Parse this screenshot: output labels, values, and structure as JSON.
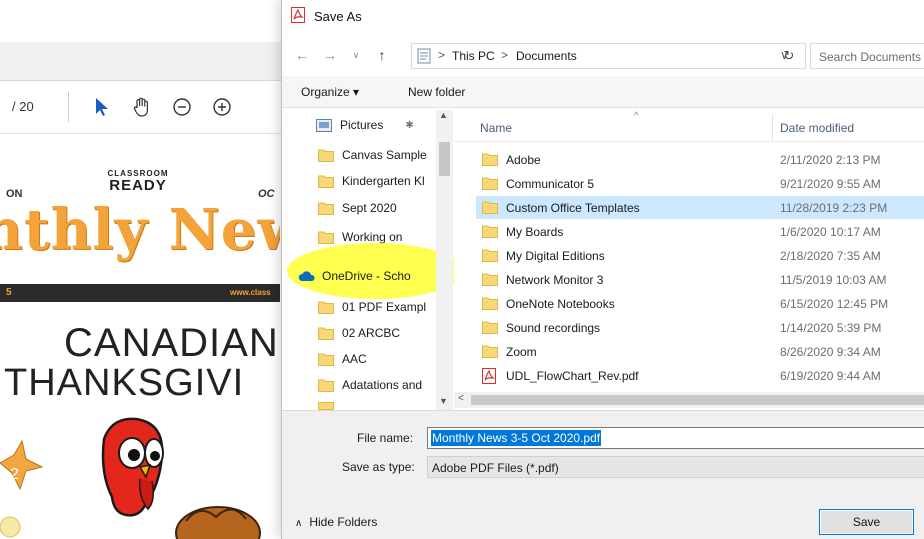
{
  "viewer": {
    "page_count": "/ 20",
    "newsletter": {
      "left_edge": "ON",
      "right_edge": "OC",
      "brand_top": "CLASSROOM",
      "brand_bottom": "READY",
      "title": "nthly New",
      "strip_left": "5",
      "strip_right": "www.class",
      "heading_1": "CANADIAN",
      "heading_2": "THANKSGIVI",
      "star_digit": "2"
    }
  },
  "dialog": {
    "title": "Save As",
    "address": {
      "crumbs": [
        "This PC",
        "Documents"
      ],
      "separator": ">"
    },
    "search_placeholder": "Search Documents",
    "toolbar": {
      "organize_label": "Organize ▾",
      "new_folder_label": "New folder"
    },
    "nav_items": [
      {
        "label": "Pictures",
        "icon": "pictures-icon",
        "pinned": true
      },
      {
        "label": "Canvas Sample",
        "icon": "folder-icon"
      },
      {
        "label": "Kindergarten Kl",
        "icon": "folder-icon"
      },
      {
        "label": "Sept 2020",
        "icon": "folder-icon"
      },
      {
        "label": "Working on",
        "icon": "folder-icon"
      },
      {
        "label": "OneDrive - Scho",
        "icon": "onedrive-icon"
      },
      {
        "label": "01 PDF Exampl",
        "icon": "folder-icon"
      },
      {
        "label": "02 ARCBC",
        "icon": "folder-icon"
      },
      {
        "label": "AAC",
        "icon": "folder-icon"
      },
      {
        "label": "Adatations and",
        "icon": "folder-icon"
      }
    ],
    "columns": {
      "name": "Name",
      "date": "Date modified"
    },
    "files": [
      {
        "name": "Adobe",
        "date": "2/11/2020 2:13 PM",
        "type": "folder"
      },
      {
        "name": "Communicator 5",
        "date": "9/21/2020 9:55 AM",
        "type": "folder"
      },
      {
        "name": "Custom Office Templates",
        "date": "11/28/2019 2:23 PM",
        "type": "folder",
        "selected": true
      },
      {
        "name": "My Boards",
        "date": "1/6/2020 10:17 AM",
        "type": "folder"
      },
      {
        "name": "My Digital Editions",
        "date": "2/18/2020 7:35 AM",
        "type": "folder"
      },
      {
        "name": "Network Monitor 3",
        "date": "11/5/2019 10:03 AM",
        "type": "folder"
      },
      {
        "name": "OneNote Notebooks",
        "date": "6/15/2020 12:45 PM",
        "type": "folder"
      },
      {
        "name": "Sound recordings",
        "date": "1/14/2020 5:39 PM",
        "type": "folder"
      },
      {
        "name": "Zoom",
        "date": "8/26/2020 9:34 AM",
        "type": "folder"
      },
      {
        "name": "UDL_FlowChart_Rev.pdf",
        "date": "6/19/2020 9:44 AM",
        "type": "pdf"
      }
    ],
    "file_name_label": "File name:",
    "file_name_value": "Monthly News 3-5 Oct 2020.pdf",
    "save_type_label": "Save as type:",
    "save_type_value": "Adobe PDF Files (*.pdf)",
    "hide_folders_label": "Hide Folders",
    "save_label": "Save",
    "colors": {
      "accent": "#0078d7",
      "selection": "#cce8ff",
      "folder": "#f8d775",
      "highlight": "#ffff28",
      "newsletter_orange": "#f3a33a"
    }
  }
}
